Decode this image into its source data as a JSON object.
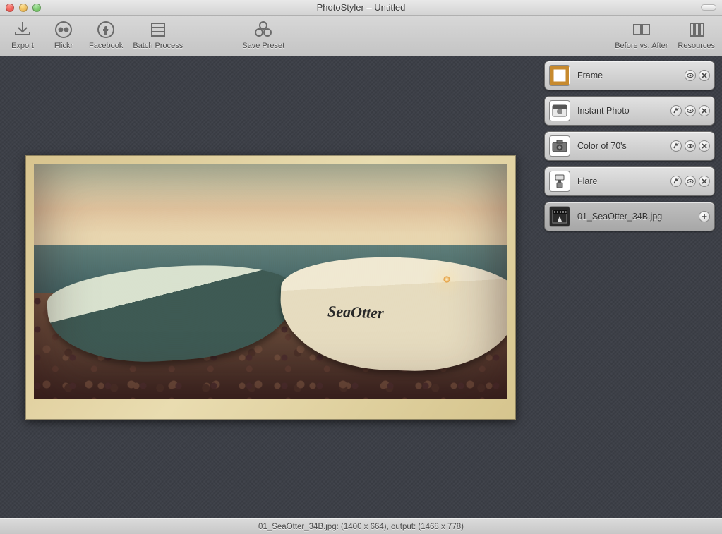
{
  "window": {
    "title": "PhotoStyler – Untitled"
  },
  "toolbar": {
    "left": [
      {
        "id": "export",
        "label": "Export",
        "icon": "export-icon"
      },
      {
        "id": "flickr",
        "label": "Flickr",
        "icon": "flickr-icon"
      },
      {
        "id": "facebook",
        "label": "Facebook",
        "icon": "facebook-icon"
      },
      {
        "id": "batch",
        "label": "Batch Process",
        "icon": "batch-icon"
      },
      {
        "id": "savepreset",
        "label": "Save Preset",
        "icon": "savepreset-icon"
      }
    ],
    "right": [
      {
        "id": "beforeafter",
        "label": "Before vs. After",
        "icon": "beforeafter-icon"
      },
      {
        "id": "resources",
        "label": "Resources",
        "icon": "resources-icon"
      }
    ]
  },
  "photo": {
    "boat_label": "SeaOtter"
  },
  "layers": [
    {
      "id": "frame",
      "label": "Frame",
      "icon": "frame-thumb",
      "actions": [
        "visibility",
        "close"
      ],
      "selected": false
    },
    {
      "id": "instant",
      "label": "Instant Photo",
      "icon": "instant-thumb",
      "actions": [
        "settings",
        "visibility",
        "close"
      ],
      "selected": false
    },
    {
      "id": "color70s",
      "label": "Color of 70's",
      "icon": "camera-thumb",
      "actions": [
        "settings",
        "visibility",
        "close"
      ],
      "selected": false
    },
    {
      "id": "flare",
      "label": "Flare",
      "icon": "flash-thumb",
      "actions": [
        "settings",
        "visibility",
        "close"
      ],
      "selected": false
    },
    {
      "id": "source",
      "label": "01_SeaOtter_34B.jpg",
      "icon": "film-thumb",
      "actions": [
        "add"
      ],
      "selected": true
    }
  ],
  "status": {
    "text": "01_SeaOtter_34B.jpg: (1400 x 664), output: (1468 x 778)"
  }
}
